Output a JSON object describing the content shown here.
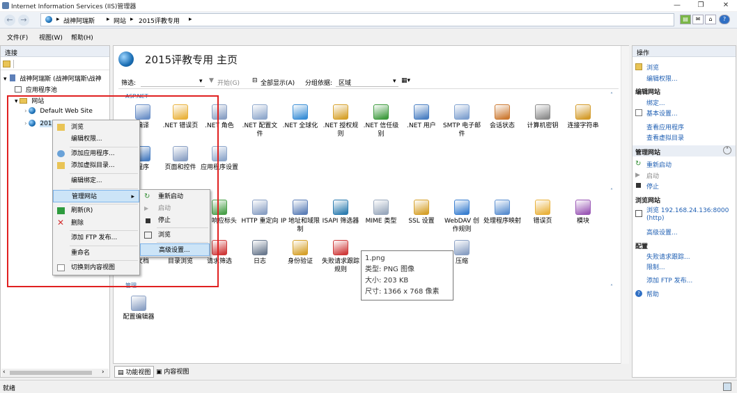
{
  "window": {
    "title": "Internet Information Services (IIS)管理器"
  },
  "address": {
    "crumbs": [
      "战神阿瑞斯",
      "网站",
      "2015评教专用"
    ]
  },
  "menu": [
    "文件(F)",
    "视图(W)",
    "帮助(H)"
  ],
  "connections": {
    "title": "连接",
    "tree": {
      "server": "战神阿瑞斯 (战神阿瑞斯\\战神",
      "app_pools": "应用程序池",
      "sites": "网站",
      "default_site": "Default Web Site",
      "selected_site": "2015评教专用"
    }
  },
  "main": {
    "title": "2015评教专用 主页",
    "filter": {
      "label": "筛选:",
      "start": "开始(G)",
      "show_all": "全部显示(A)",
      "group_label": "分组依据:",
      "group_value": "区域"
    },
    "sections": [
      "ASP.NET",
      "管理"
    ],
    "features_row1": [
      {
        "label": "编译",
        "icon": "compile-icon",
        "color": "#6a8fc7"
      },
      {
        "label": ".NET 错误页",
        "icon": "error-page-icon",
        "color": "#e9b23c"
      },
      {
        "label": ".NET 角色",
        "icon": "roles-icon",
        "color": "#8aa0c4"
      },
      {
        "label": ".NET 配置文件",
        "icon": "profile-icon",
        "color": "#8fa8cc"
      },
      {
        "label": ".NET 全球化",
        "icon": "globalization-icon",
        "color": "#3a8ed6"
      },
      {
        "label": ".NET 授权规则",
        "icon": "authorization-icon",
        "color": "#d6a12b"
      },
      {
        "label": ".NET 信任级别",
        "icon": "trust-icon",
        "color": "#3e9b3e"
      },
      {
        "label": ".NET 用户",
        "icon": "users-icon",
        "color": "#4b7fc2"
      },
      {
        "label": "SMTP 电子邮件",
        "icon": "smtp-icon",
        "color": "#7ea0cf"
      },
      {
        "label": "会话状态",
        "icon": "session-icon",
        "color": "#cc7a33"
      },
      {
        "label": "计算机密钥",
        "icon": "machine-key-icon",
        "color": "#8b8b8b"
      },
      {
        "label": "连接字符串",
        "icon": "connection-string-icon",
        "color": "#d39b2a"
      }
    ],
    "features_row2": [
      {
        "label": "程序",
        "icon": "app-settings-icon",
        "color": "#4b7fc2"
      },
      {
        "label": "页面和控件",
        "icon": "pages-controls-icon",
        "color": "#8aa0c4"
      },
      {
        "label": "应用程序设置",
        "icon": "app-config-icon",
        "color": "#8fa8cc"
      }
    ],
    "features_row3": [
      {
        "label": "TP 响应标头",
        "icon": "response-headers-icon",
        "color": "#4aa04a"
      },
      {
        "label": "HTTP 重定向",
        "icon": "redirect-icon",
        "color": "#8aa0c4"
      },
      {
        "label": "IP 地址和域限制",
        "icon": "ip-restrictions-icon",
        "color": "#5d7fb8"
      },
      {
        "label": "ISAPI 筛选器",
        "icon": "isapi-filter-icon",
        "color": "#2e7db0"
      },
      {
        "label": "MIME 类型",
        "icon": "mime-icon",
        "color": "#9aa9bd"
      },
      {
        "label": "SSL 设置",
        "icon": "ssl-icon",
        "color": "#d6a12b"
      },
      {
        "label": "WebDAV 创作规则",
        "icon": "webdav-icon",
        "color": "#3a7fd0"
      },
      {
        "label": "处理程序映射",
        "icon": "handler-mappings-icon",
        "color": "#5b8fd0"
      },
      {
        "label": "错误页",
        "icon": "error-pages-icon",
        "color": "#e9b23c"
      },
      {
        "label": "模块",
        "icon": "modules-icon",
        "color": "#9b59b6"
      }
    ],
    "features_row4": [
      {
        "label": "文档",
        "icon": "default-doc-icon",
        "color": "#8aa0c4"
      },
      {
        "label": "目录浏览",
        "icon": "dir-browse-icon",
        "color": "#8fa8cc"
      },
      {
        "label": "请求筛选",
        "icon": "request-filter-icon",
        "color": "#cf3b3b"
      },
      {
        "label": "日志",
        "icon": "logging-icon",
        "color": "#6b7a8f"
      },
      {
        "label": "身份验证",
        "icon": "authentication-icon",
        "color": "#d6a12b"
      },
      {
        "label": "失败请求跟踪规则",
        "icon": "failed-request-icon",
        "color": "#cf3b3b"
      },
      {
        "label": "压缩",
        "icon": "compression-icon",
        "color": "#8aa0c4"
      }
    ],
    "management": [
      {
        "label": "配置编辑器",
        "icon": "config-editor-icon",
        "color": "#8aa0c4"
      }
    ],
    "views": {
      "features": "功能视图",
      "content": "内容视图"
    }
  },
  "context_menu": {
    "items": [
      "浏览",
      "编辑权限...",
      "添加应用程序...",
      "添加虚拟目录...",
      "编辑绑定...",
      "管理网站",
      "刷新(R)",
      "删除",
      "添加 FTP 发布...",
      "重命名",
      "切换到内容视图"
    ]
  },
  "submenu": {
    "items": [
      "重新启动",
      "启动",
      "停止",
      "浏览",
      "高级设置..."
    ]
  },
  "tooltip": {
    "name": "1.png",
    "type": "类型: PNG 图像",
    "size": "大小: 203 KB",
    "dims": "尺寸: 1366 x 768 像素"
  },
  "actions": {
    "title": "操作",
    "browse": "浏览",
    "edit_permissions": "编辑权限...",
    "edit_site": "编辑网站",
    "bindings": "绑定...",
    "basic_settings": "基本设置...",
    "view_apps": "查看应用程序",
    "view_vdirs": "查看虚拟目录",
    "manage_site": "管理网站",
    "restart": "重新启动",
    "start": "启动",
    "stop": "停止",
    "browse_site": "浏览网站",
    "browse_link": "浏览 192.168.24.136:8000",
    "browse_proto": "(http)",
    "advanced": "高级设置...",
    "config": "配置",
    "failed_tracing": "失败请求跟踪...",
    "limits": "限制...",
    "add_ftp": "添加 FTP 发布...",
    "help": "帮助"
  },
  "status": {
    "text": "就绪"
  },
  "colors": {
    "accent": "#1f5fb3",
    "highlight": "#cce4f7",
    "red_box": "#e02020"
  }
}
